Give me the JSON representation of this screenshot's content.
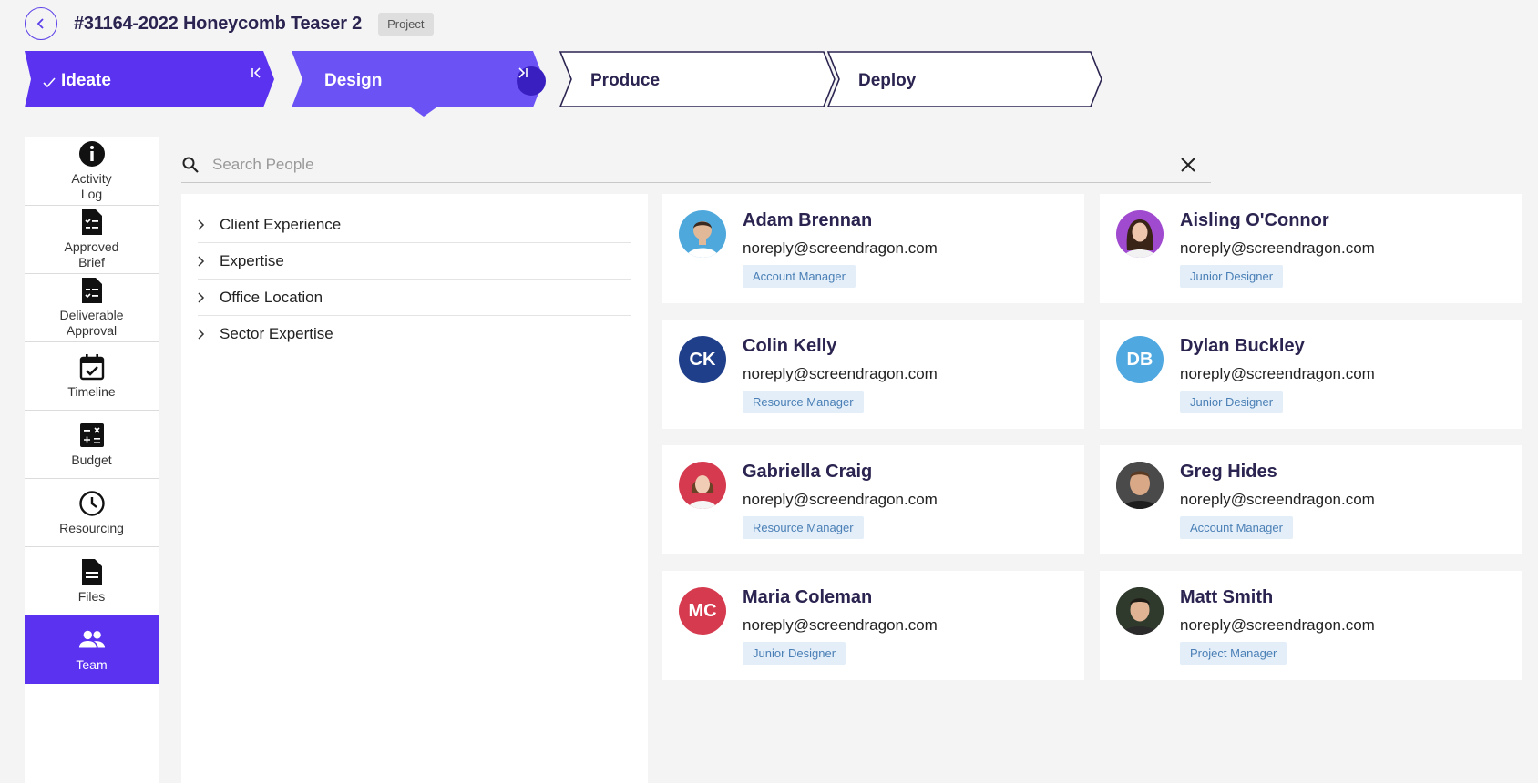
{
  "header": {
    "title": "#31164-2022 Honeycomb Teaser 2",
    "badge": "Project"
  },
  "stages": [
    {
      "label": "Ideate",
      "status": "complete",
      "color": "#5a32f0"
    },
    {
      "label": "Design",
      "status": "current",
      "color": "#6b52f5"
    },
    {
      "label": "Produce",
      "status": "upcoming"
    },
    {
      "label": "Deploy",
      "status": "upcoming"
    }
  ],
  "sidebar": {
    "items": [
      {
        "label": "Activity\nLog",
        "icon": "info-icon"
      },
      {
        "label": "Approved\nBrief",
        "icon": "checklist-doc-icon"
      },
      {
        "label": "Deliverable\nApproval",
        "icon": "checklist-doc-icon"
      },
      {
        "label": "Timeline",
        "icon": "calendar-check-icon"
      },
      {
        "label": "Budget",
        "icon": "calculator-icon"
      },
      {
        "label": "Resourcing",
        "icon": "clock-icon"
      },
      {
        "label": "Files",
        "icon": "file-icon"
      },
      {
        "label": "Team",
        "icon": "people-icon",
        "active": true
      }
    ]
  },
  "search": {
    "placeholder": "Search People",
    "value": ""
  },
  "filters": [
    {
      "label": "Client Experience"
    },
    {
      "label": "Expertise"
    },
    {
      "label": "Office Location"
    },
    {
      "label": "Sector Expertise"
    }
  ],
  "people": [
    {
      "name": "Adam Brennan",
      "email": "noreply@screendragon.com",
      "role": "Account Manager",
      "avatar": "photo",
      "color": "#4ea8dc"
    },
    {
      "name": "Aisling O'Connor",
      "email": "noreply@screendragon.com",
      "role": "Junior Designer",
      "avatar": "photo",
      "color": "#a04ad0"
    },
    {
      "name": "Colin Kelly",
      "email": "noreply@screendragon.com",
      "role": "Resource Manager",
      "initials": "CK",
      "color": "#1f3f8a"
    },
    {
      "name": "Dylan Buckley",
      "email": "noreply@screendragon.com",
      "role": "Junior Designer",
      "initials": "DB",
      "color": "#4fa8e0"
    },
    {
      "name": "Gabriella Craig",
      "email": "noreply@screendragon.com",
      "role": "Resource Manager",
      "avatar": "photo",
      "color": "#d63a4e"
    },
    {
      "name": "Greg Hides",
      "email": "noreply@screendragon.com",
      "role": "Account Manager",
      "avatar": "photo",
      "color": "#3a3a3a"
    },
    {
      "name": "Maria Coleman",
      "email": "noreply@screendragon.com",
      "role": "Junior Designer",
      "initials": "MC",
      "color": "#d63a4e"
    },
    {
      "name": "Matt Smith",
      "email": "noreply@screendragon.com",
      "role": "Project Manager",
      "avatar": "photo",
      "color": "#2a2a2a"
    }
  ]
}
